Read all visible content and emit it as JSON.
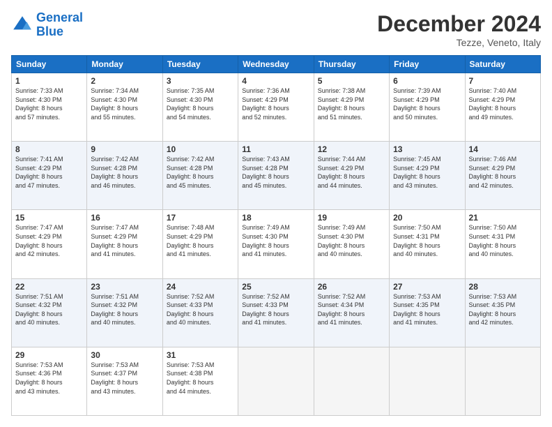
{
  "header": {
    "logo_line1": "General",
    "logo_line2": "Blue",
    "month_title": "December 2024",
    "location": "Tezze, Veneto, Italy"
  },
  "weekdays": [
    "Sunday",
    "Monday",
    "Tuesday",
    "Wednesday",
    "Thursday",
    "Friday",
    "Saturday"
  ],
  "weeks": [
    [
      {
        "day": "1",
        "info": "Sunrise: 7:33 AM\nSunset: 4:30 PM\nDaylight: 8 hours\nand 57 minutes."
      },
      {
        "day": "2",
        "info": "Sunrise: 7:34 AM\nSunset: 4:30 PM\nDaylight: 8 hours\nand 55 minutes."
      },
      {
        "day": "3",
        "info": "Sunrise: 7:35 AM\nSunset: 4:30 PM\nDaylight: 8 hours\nand 54 minutes."
      },
      {
        "day": "4",
        "info": "Sunrise: 7:36 AM\nSunset: 4:29 PM\nDaylight: 8 hours\nand 52 minutes."
      },
      {
        "day": "5",
        "info": "Sunrise: 7:38 AM\nSunset: 4:29 PM\nDaylight: 8 hours\nand 51 minutes."
      },
      {
        "day": "6",
        "info": "Sunrise: 7:39 AM\nSunset: 4:29 PM\nDaylight: 8 hours\nand 50 minutes."
      },
      {
        "day": "7",
        "info": "Sunrise: 7:40 AM\nSunset: 4:29 PM\nDaylight: 8 hours\nand 49 minutes."
      }
    ],
    [
      {
        "day": "8",
        "info": "Sunrise: 7:41 AM\nSunset: 4:29 PM\nDaylight: 8 hours\nand 47 minutes."
      },
      {
        "day": "9",
        "info": "Sunrise: 7:42 AM\nSunset: 4:28 PM\nDaylight: 8 hours\nand 46 minutes."
      },
      {
        "day": "10",
        "info": "Sunrise: 7:42 AM\nSunset: 4:28 PM\nDaylight: 8 hours\nand 45 minutes."
      },
      {
        "day": "11",
        "info": "Sunrise: 7:43 AM\nSunset: 4:28 PM\nDaylight: 8 hours\nand 45 minutes."
      },
      {
        "day": "12",
        "info": "Sunrise: 7:44 AM\nSunset: 4:29 PM\nDaylight: 8 hours\nand 44 minutes."
      },
      {
        "day": "13",
        "info": "Sunrise: 7:45 AM\nSunset: 4:29 PM\nDaylight: 8 hours\nand 43 minutes."
      },
      {
        "day": "14",
        "info": "Sunrise: 7:46 AM\nSunset: 4:29 PM\nDaylight: 8 hours\nand 42 minutes."
      }
    ],
    [
      {
        "day": "15",
        "info": "Sunrise: 7:47 AM\nSunset: 4:29 PM\nDaylight: 8 hours\nand 42 minutes."
      },
      {
        "day": "16",
        "info": "Sunrise: 7:47 AM\nSunset: 4:29 PM\nDaylight: 8 hours\nand 41 minutes."
      },
      {
        "day": "17",
        "info": "Sunrise: 7:48 AM\nSunset: 4:29 PM\nDaylight: 8 hours\nand 41 minutes."
      },
      {
        "day": "18",
        "info": "Sunrise: 7:49 AM\nSunset: 4:30 PM\nDaylight: 8 hours\nand 41 minutes."
      },
      {
        "day": "19",
        "info": "Sunrise: 7:49 AM\nSunset: 4:30 PM\nDaylight: 8 hours\nand 40 minutes."
      },
      {
        "day": "20",
        "info": "Sunrise: 7:50 AM\nSunset: 4:31 PM\nDaylight: 8 hours\nand 40 minutes."
      },
      {
        "day": "21",
        "info": "Sunrise: 7:50 AM\nSunset: 4:31 PM\nDaylight: 8 hours\nand 40 minutes."
      }
    ],
    [
      {
        "day": "22",
        "info": "Sunrise: 7:51 AM\nSunset: 4:32 PM\nDaylight: 8 hours\nand 40 minutes."
      },
      {
        "day": "23",
        "info": "Sunrise: 7:51 AM\nSunset: 4:32 PM\nDaylight: 8 hours\nand 40 minutes."
      },
      {
        "day": "24",
        "info": "Sunrise: 7:52 AM\nSunset: 4:33 PM\nDaylight: 8 hours\nand 40 minutes."
      },
      {
        "day": "25",
        "info": "Sunrise: 7:52 AM\nSunset: 4:33 PM\nDaylight: 8 hours\nand 41 minutes."
      },
      {
        "day": "26",
        "info": "Sunrise: 7:52 AM\nSunset: 4:34 PM\nDaylight: 8 hours\nand 41 minutes."
      },
      {
        "day": "27",
        "info": "Sunrise: 7:53 AM\nSunset: 4:35 PM\nDaylight: 8 hours\nand 41 minutes."
      },
      {
        "day": "28",
        "info": "Sunrise: 7:53 AM\nSunset: 4:35 PM\nDaylight: 8 hours\nand 42 minutes."
      }
    ],
    [
      {
        "day": "29",
        "info": "Sunrise: 7:53 AM\nSunset: 4:36 PM\nDaylight: 8 hours\nand 43 minutes."
      },
      {
        "day": "30",
        "info": "Sunrise: 7:53 AM\nSunset: 4:37 PM\nDaylight: 8 hours\nand 43 minutes."
      },
      {
        "day": "31",
        "info": "Sunrise: 7:53 AM\nSunset: 4:38 PM\nDaylight: 8 hours\nand 44 minutes."
      },
      null,
      null,
      null,
      null
    ]
  ]
}
